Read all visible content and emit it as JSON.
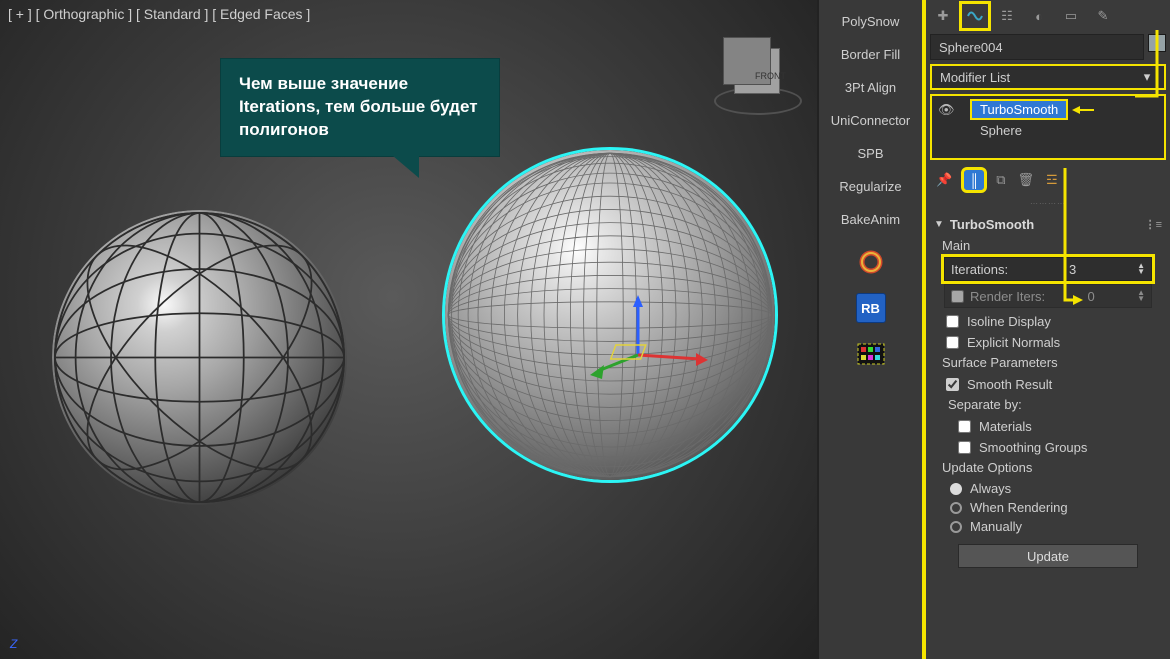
{
  "viewport": {
    "label": "[ + ] [ Orthographic ] [ Standard ] [ Edged Faces ]",
    "callout": "Чем выше значение Iterations, тем больше будет полигонов",
    "axis": "Z",
    "viewcube": "FRONT"
  },
  "toolbar": {
    "items": [
      "PolySnow",
      "Border Fill",
      "3Pt Align",
      "UniConnector",
      "SPB",
      "Regularize",
      "BakeAnim"
    ],
    "rb": "RB"
  },
  "cmd": {
    "object_name": "Sphere004",
    "modifier_list": "Modifier List",
    "stack": {
      "item_sel": "TurboSmooth",
      "item_base": "Sphere"
    },
    "rollout": {
      "title": "TurboSmooth",
      "main": "Main",
      "iterations_label": "Iterations:",
      "iterations_value": "3",
      "render_iters_label": "Render Iters:",
      "render_iters_value": "0",
      "isoline": "Isoline Display",
      "explicit": "Explicit Normals",
      "surf_group": "Surface Parameters",
      "smooth_result": "Smooth Result",
      "separate": "Separate by:",
      "materials": "Materials",
      "smgroups": "Smoothing Groups",
      "update_group": "Update Options",
      "always": "Always",
      "when_rendering": "When Rendering",
      "manually": "Manually",
      "update_btn": "Update"
    }
  }
}
